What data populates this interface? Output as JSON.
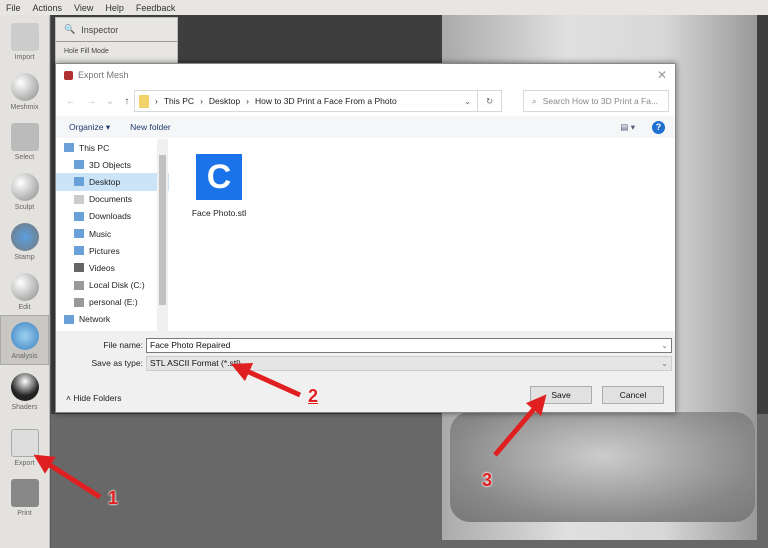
{
  "menu": [
    "File",
    "Actions",
    "View",
    "Help",
    "Feedback"
  ],
  "tools": [
    {
      "label": "Import"
    },
    {
      "label": "Meshmix"
    },
    {
      "label": "Select"
    },
    {
      "label": "Sculpt"
    },
    {
      "label": "Stamp"
    },
    {
      "label": "Edit"
    },
    {
      "label": "Analysis",
      "selected": true
    },
    {
      "label": "Shaders"
    },
    {
      "label": "Export"
    },
    {
      "label": "Print"
    }
  ],
  "inspector": {
    "title": "Inspector",
    "mode": "Hole Fill Mode"
  },
  "dialog": {
    "title": "Export Mesh",
    "path": [
      "This PC",
      "Desktop",
      "How to 3D Print a Face From a Photo"
    ],
    "search_placeholder": "Search How to 3D Print a Fa...",
    "organize": "Organize ▾",
    "new_folder": "New folder",
    "tree": [
      {
        "label": "This PC"
      },
      {
        "label": "3D Objects"
      },
      {
        "label": "Desktop",
        "selected": true
      },
      {
        "label": "Documents"
      },
      {
        "label": "Downloads"
      },
      {
        "label": "Music"
      },
      {
        "label": "Pictures"
      },
      {
        "label": "Videos"
      },
      {
        "label": "Local Disk (C:)"
      },
      {
        "label": "personal (E:)"
      },
      {
        "label": "Network"
      }
    ],
    "files": [
      {
        "name": "Face Photo.stl",
        "icon": "C"
      }
    ],
    "file_name_label": "File name:",
    "file_name": "Face Photo Repaired",
    "save_type_label": "Save as type:",
    "save_type": "STL ASCII Format (*.stl)",
    "hide_folders": "Hide Folders",
    "save": "Save",
    "cancel": "Cancel"
  },
  "annotations": {
    "n1": "1",
    "n2": "2",
    "n3": "3",
    "color": "#e02020"
  }
}
